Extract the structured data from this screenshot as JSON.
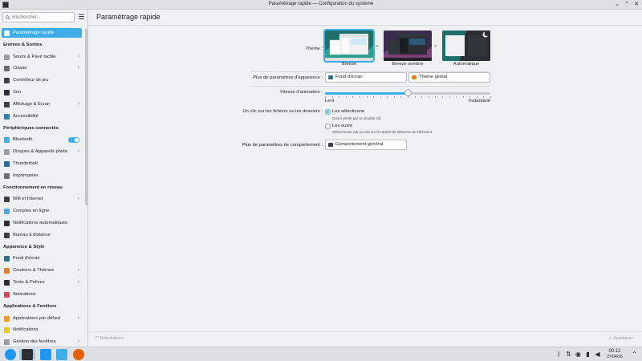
{
  "window": {
    "title": "Paramétrage rapide — Configuration du système",
    "min_label": "⌄",
    "max_label": "⌃",
    "close_label": "✕"
  },
  "sidebar": {
    "search_placeholder": "Rechercher...",
    "menu_icon": "☰",
    "items": [
      {
        "type": "item",
        "label": "Paramétrage rapide",
        "selected": true,
        "icon": "quick-setup-icon",
        "color": "#3daee9"
      },
      {
        "type": "section",
        "label": "Entrées & Sorties"
      },
      {
        "type": "item",
        "label": "Souris & Pavé tactile",
        "chevron": true,
        "icon": "mouse-icon",
        "color": "#9a9da1"
      },
      {
        "type": "item",
        "label": "Clavier",
        "chevron": true,
        "icon": "keyboard-icon",
        "color": "#6b6e72"
      },
      {
        "type": "item",
        "label": "Contrôleur de jeu",
        "icon": "gamepad-icon",
        "color": "#3b3e42"
      },
      {
        "type": "item",
        "label": "Son",
        "icon": "speaker-icon",
        "color": "#2b2e33"
      },
      {
        "type": "item",
        "label": "Affichage & Écran",
        "chevron": true,
        "icon": "display-icon",
        "color": "#3b3e42"
      },
      {
        "type": "item",
        "label": "Accessibilité",
        "icon": "accessibility-icon",
        "color": "#2980b9"
      },
      {
        "type": "section",
        "label": "Périphériques connectés"
      },
      {
        "type": "item",
        "label": "Bluetooth",
        "toggle": true,
        "icon": "bluetooth-icon",
        "color": "#3daee9"
      },
      {
        "type": "item",
        "label": "Disques & Appareils photo",
        "chevron": true,
        "icon": "disk-icon",
        "color": "#9a9da1"
      },
      {
        "type": "item",
        "label": "Thunderbolt",
        "icon": "thunderbolt-icon",
        "color": "#1d6fa5"
      },
      {
        "type": "item",
        "label": "Imprimantes",
        "icon": "printer-icon",
        "color": "#6b6e72"
      },
      {
        "type": "section",
        "label": "Fonctionnement en réseau"
      },
      {
        "type": "item",
        "label": "Wifi et Internet",
        "chevron": true,
        "icon": "network-icon",
        "color": "#3b3e42"
      },
      {
        "type": "item",
        "label": "Comptes en ligne",
        "icon": "online-accounts-icon",
        "color": "#3daee9"
      },
      {
        "type": "item",
        "label": "Notifications automatiques",
        "icon": "notification-icon",
        "color": "#2b2e33"
      },
      {
        "type": "item",
        "label": "Bureau à distance",
        "icon": "remote-desktop-icon",
        "color": "#3b3e42"
      },
      {
        "type": "section",
        "label": "Apparence & Style"
      },
      {
        "type": "item",
        "label": "Fond d'écran",
        "icon": "wallpaper-icon",
        "color": "#2e6f8e"
      },
      {
        "type": "item",
        "label": "Couleurs & Thèmes",
        "chevron": true,
        "icon": "palette-icon",
        "color": "#e67e22"
      },
      {
        "type": "item",
        "label": "Texte & Polices",
        "chevron": true,
        "icon": "font-icon",
        "color": "#2b2e33"
      },
      {
        "type": "item",
        "label": "Animations",
        "icon": "animation-icon",
        "color": "#da4453"
      },
      {
        "type": "section",
        "label": "Applications & Fenêtres"
      },
      {
        "type": "item",
        "label": "Applications par défaut",
        "chevron": true,
        "icon": "default-apps-icon",
        "color": "#f39c12"
      },
      {
        "type": "item",
        "label": "Notifications",
        "icon": "bell-icon",
        "color": "#f1c40f"
      },
      {
        "type": "item",
        "label": "Gestion des fenêtres",
        "chevron": true,
        "icon": "window-management-icon",
        "color": "#9a9da1"
      }
    ]
  },
  "main": {
    "page_title": "Paramétrage rapide",
    "theme_label": "Thème :",
    "themes": [
      {
        "name": "Breeze",
        "selected": true
      },
      {
        "name": "Breeze sombre",
        "selected": false
      },
      {
        "name": "Automatique",
        "selected": false
      }
    ],
    "appearance_label": "Plus de paramètres d'apparence :",
    "wallpaper_button": "Fond d'écran",
    "global_theme_button": "Thème global",
    "animation_label": "Vitesse d'animation :",
    "animation_slow": "Lent",
    "animation_fast": "Instantané",
    "animation_level": 0.5,
    "click_label": "Un clic sur les fichiers ou les dossiers :",
    "option_select": "Les sélectionne",
    "option_select_note": "Ouvrir plutôt par un double clic",
    "option_open": "Les ouvre",
    "option_open_note": "Sélectionner par un clic sur le repère de sélection de l'élément",
    "behavior_label": "Plus de paramètres de comportement :",
    "general_behavior_button": "Comportement général",
    "reset_button": "Réinitialiser",
    "apply_button": "Appliquer"
  },
  "taskbar": {
    "time": "00:12",
    "date": "27/04/26",
    "tray_bluetooth": "ᛒ",
    "tray_network": "⇅",
    "tray_wifi": "◉",
    "tray_power": "▮",
    "tray_volume": "◀",
    "tray_expand": "⌃"
  }
}
